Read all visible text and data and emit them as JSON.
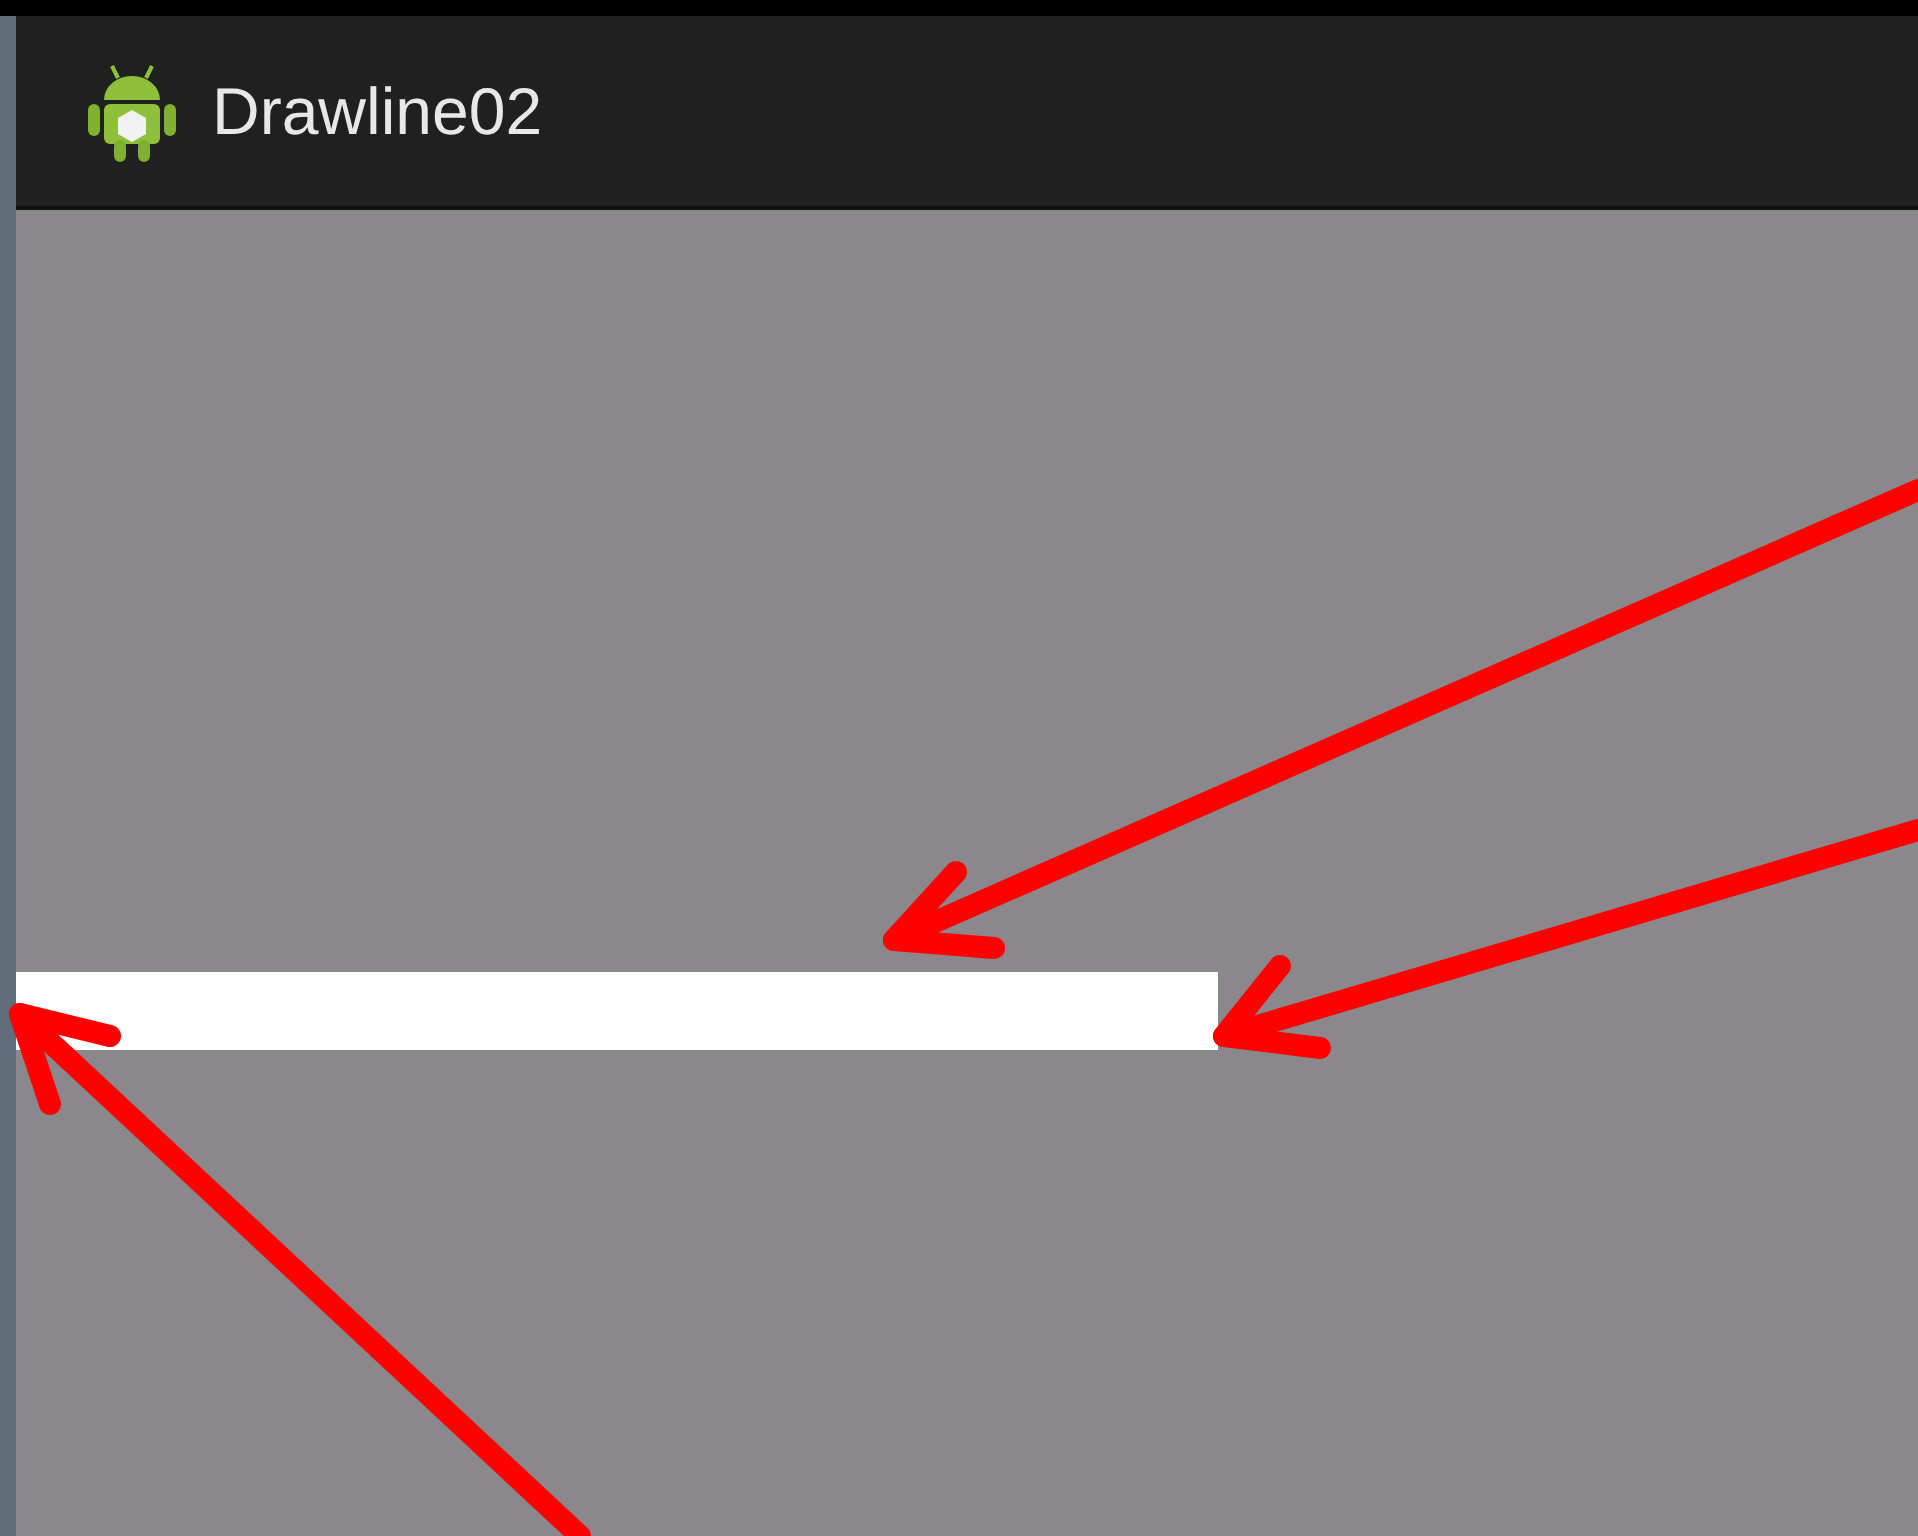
{
  "action_bar": {
    "title": "Drawline02"
  }
}
